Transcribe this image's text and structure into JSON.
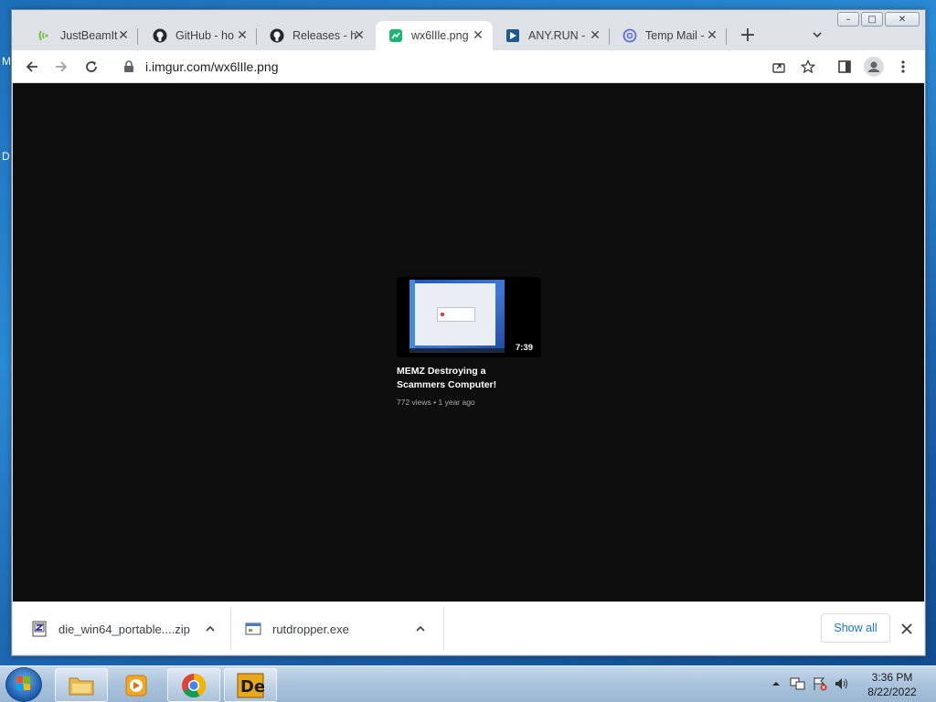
{
  "desktop": {
    "letters": [
      "M",
      "D"
    ]
  },
  "tabs": [
    {
      "title": "JustBeamIt",
      "icon": "justbeamit-icon"
    },
    {
      "title": "GitHub - ho",
      "icon": "github-icon"
    },
    {
      "title": "Releases - h",
      "icon": "github-icon"
    },
    {
      "title": "wx6lIle.png",
      "icon": "imgur-icon",
      "active": true
    },
    {
      "title": "ANY.RUN -",
      "icon": "anyrun-icon"
    },
    {
      "title": "Temp Mail -",
      "icon": "tempmail-icon"
    }
  ],
  "toolbar": {
    "url": "i.imgur.com/wx6lIle.png"
  },
  "video": {
    "duration": "7:39",
    "title": "MEMZ Destroying a Scammers Computer!",
    "meta": "772 views • 1 year ago"
  },
  "downloads": {
    "items": [
      {
        "name": "die_win64_portable....zip"
      },
      {
        "name": "rutdropper.exe"
      }
    ],
    "show_all": "Show all"
  },
  "taskbar": {
    "time": "3:36 PM",
    "date": "8/22/2022"
  }
}
